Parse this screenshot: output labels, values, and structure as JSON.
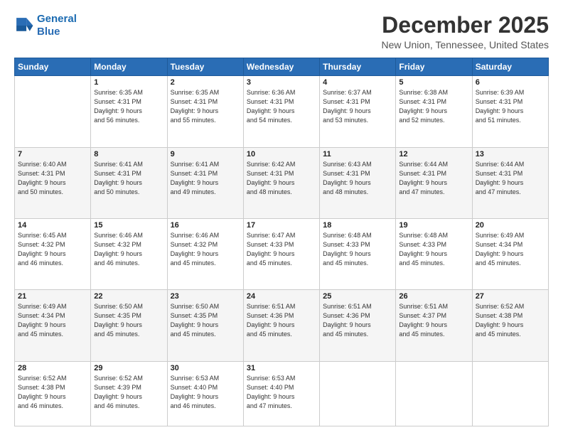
{
  "logo": {
    "line1": "General",
    "line2": "Blue"
  },
  "header": {
    "month": "December 2025",
    "location": "New Union, Tennessee, United States"
  },
  "weekdays": [
    "Sunday",
    "Monday",
    "Tuesday",
    "Wednesday",
    "Thursday",
    "Friday",
    "Saturday"
  ],
  "weeks": [
    [
      {
        "day": "",
        "info": ""
      },
      {
        "day": "1",
        "info": "Sunrise: 6:35 AM\nSunset: 4:31 PM\nDaylight: 9 hours\nand 56 minutes."
      },
      {
        "day": "2",
        "info": "Sunrise: 6:35 AM\nSunset: 4:31 PM\nDaylight: 9 hours\nand 55 minutes."
      },
      {
        "day": "3",
        "info": "Sunrise: 6:36 AM\nSunset: 4:31 PM\nDaylight: 9 hours\nand 54 minutes."
      },
      {
        "day": "4",
        "info": "Sunrise: 6:37 AM\nSunset: 4:31 PM\nDaylight: 9 hours\nand 53 minutes."
      },
      {
        "day": "5",
        "info": "Sunrise: 6:38 AM\nSunset: 4:31 PM\nDaylight: 9 hours\nand 52 minutes."
      },
      {
        "day": "6",
        "info": "Sunrise: 6:39 AM\nSunset: 4:31 PM\nDaylight: 9 hours\nand 51 minutes."
      }
    ],
    [
      {
        "day": "7",
        "info": "Sunrise: 6:40 AM\nSunset: 4:31 PM\nDaylight: 9 hours\nand 50 minutes."
      },
      {
        "day": "8",
        "info": "Sunrise: 6:41 AM\nSunset: 4:31 PM\nDaylight: 9 hours\nand 50 minutes."
      },
      {
        "day": "9",
        "info": "Sunrise: 6:41 AM\nSunset: 4:31 PM\nDaylight: 9 hours\nand 49 minutes."
      },
      {
        "day": "10",
        "info": "Sunrise: 6:42 AM\nSunset: 4:31 PM\nDaylight: 9 hours\nand 48 minutes."
      },
      {
        "day": "11",
        "info": "Sunrise: 6:43 AM\nSunset: 4:31 PM\nDaylight: 9 hours\nand 48 minutes."
      },
      {
        "day": "12",
        "info": "Sunrise: 6:44 AM\nSunset: 4:31 PM\nDaylight: 9 hours\nand 47 minutes."
      },
      {
        "day": "13",
        "info": "Sunrise: 6:44 AM\nSunset: 4:31 PM\nDaylight: 9 hours\nand 47 minutes."
      }
    ],
    [
      {
        "day": "14",
        "info": "Sunrise: 6:45 AM\nSunset: 4:32 PM\nDaylight: 9 hours\nand 46 minutes."
      },
      {
        "day": "15",
        "info": "Sunrise: 6:46 AM\nSunset: 4:32 PM\nDaylight: 9 hours\nand 46 minutes."
      },
      {
        "day": "16",
        "info": "Sunrise: 6:46 AM\nSunset: 4:32 PM\nDaylight: 9 hours\nand 45 minutes."
      },
      {
        "day": "17",
        "info": "Sunrise: 6:47 AM\nSunset: 4:33 PM\nDaylight: 9 hours\nand 45 minutes."
      },
      {
        "day": "18",
        "info": "Sunrise: 6:48 AM\nSunset: 4:33 PM\nDaylight: 9 hours\nand 45 minutes."
      },
      {
        "day": "19",
        "info": "Sunrise: 6:48 AM\nSunset: 4:33 PM\nDaylight: 9 hours\nand 45 minutes."
      },
      {
        "day": "20",
        "info": "Sunrise: 6:49 AM\nSunset: 4:34 PM\nDaylight: 9 hours\nand 45 minutes."
      }
    ],
    [
      {
        "day": "21",
        "info": "Sunrise: 6:49 AM\nSunset: 4:34 PM\nDaylight: 9 hours\nand 45 minutes."
      },
      {
        "day": "22",
        "info": "Sunrise: 6:50 AM\nSunset: 4:35 PM\nDaylight: 9 hours\nand 45 minutes."
      },
      {
        "day": "23",
        "info": "Sunrise: 6:50 AM\nSunset: 4:35 PM\nDaylight: 9 hours\nand 45 minutes."
      },
      {
        "day": "24",
        "info": "Sunrise: 6:51 AM\nSunset: 4:36 PM\nDaylight: 9 hours\nand 45 minutes."
      },
      {
        "day": "25",
        "info": "Sunrise: 6:51 AM\nSunset: 4:36 PM\nDaylight: 9 hours\nand 45 minutes."
      },
      {
        "day": "26",
        "info": "Sunrise: 6:51 AM\nSunset: 4:37 PM\nDaylight: 9 hours\nand 45 minutes."
      },
      {
        "day": "27",
        "info": "Sunrise: 6:52 AM\nSunset: 4:38 PM\nDaylight: 9 hours\nand 45 minutes."
      }
    ],
    [
      {
        "day": "28",
        "info": "Sunrise: 6:52 AM\nSunset: 4:38 PM\nDaylight: 9 hours\nand 46 minutes."
      },
      {
        "day": "29",
        "info": "Sunrise: 6:52 AM\nSunset: 4:39 PM\nDaylight: 9 hours\nand 46 minutes."
      },
      {
        "day": "30",
        "info": "Sunrise: 6:53 AM\nSunset: 4:40 PM\nDaylight: 9 hours\nand 46 minutes."
      },
      {
        "day": "31",
        "info": "Sunrise: 6:53 AM\nSunset: 4:40 PM\nDaylight: 9 hours\nand 47 minutes."
      },
      {
        "day": "",
        "info": ""
      },
      {
        "day": "",
        "info": ""
      },
      {
        "day": "",
        "info": ""
      }
    ]
  ]
}
